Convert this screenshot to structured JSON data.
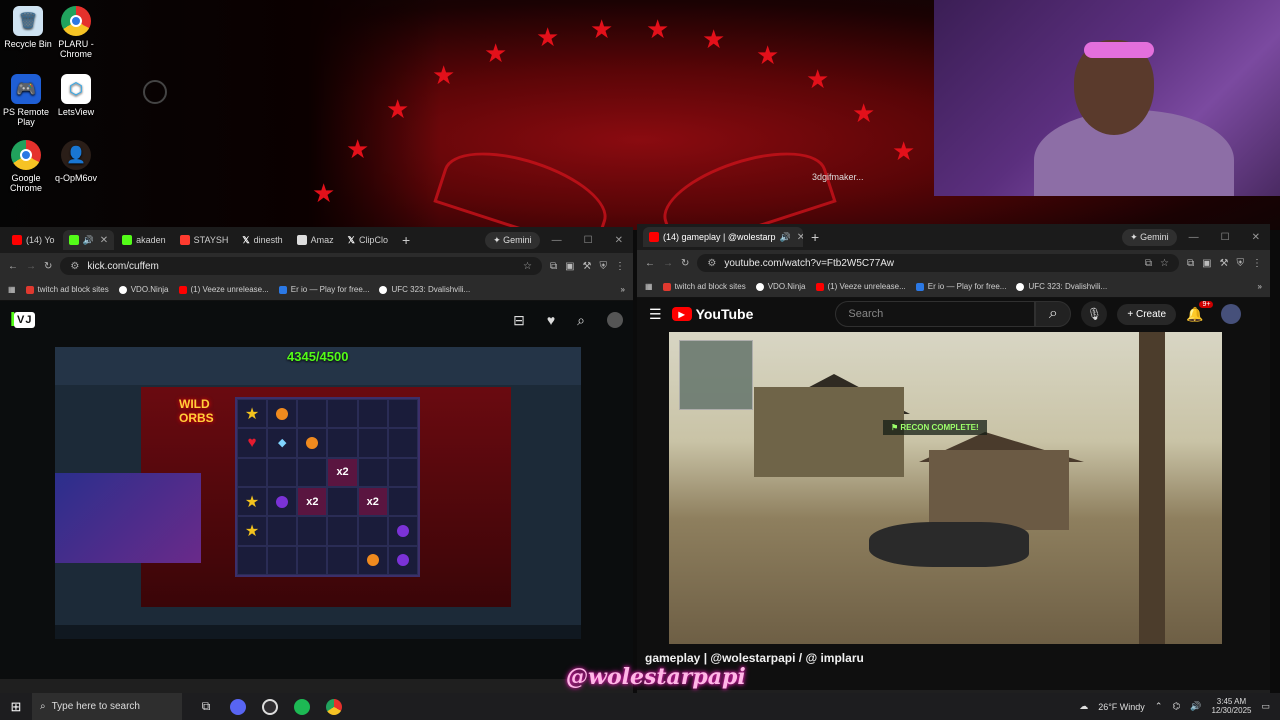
{
  "desktop": {
    "icons": [
      {
        "label": "Recycle Bin",
        "icon": "recycle-bin-icon",
        "color": "#9ecbea"
      },
      {
        "label": "PLARU - Chrome",
        "icon": "chrome-icon",
        "color": "#e5312c"
      },
      {
        "label": "PS Remote Play",
        "icon": "ps-remote-play-icon",
        "color": "#1f5fd6"
      },
      {
        "label": "LetsView",
        "icon": "letsview-icon",
        "color": "#2ea7e9"
      },
      {
        "label": "Google Chrome",
        "icon": "chrome-icon",
        "color": "#e5312c"
      },
      {
        "label": "q-OpM6ov",
        "icon": "user-avatar-icon",
        "color": "#6a4a3a"
      }
    ],
    "overlay_label": "3dgifmaker..."
  },
  "kick_window": {
    "tabs": [
      {
        "label": "(14) Yo",
        "icon": "youtube-icon",
        "color": "#ff0000"
      },
      {
        "label": "",
        "icon": "kick-icon",
        "color": "#53fc18",
        "active": true
      },
      {
        "label": "akaden",
        "icon": "kick-icon",
        "color": "#53fc18"
      },
      {
        "label": "STAYSH",
        "icon": "youtube-icon",
        "color": "#ff3b2f"
      },
      {
        "label": "dinesth",
        "icon": "x-icon",
        "color": "#ffffff"
      },
      {
        "label": "Amaz",
        "icon": "amazon-icon",
        "color": "#dddddd"
      },
      {
        "label": "ClipClo",
        "icon": "x-icon",
        "color": "#ffffff"
      }
    ],
    "gemini_label": "Gemini",
    "url": "kick.com/cuffem",
    "bookmarks": [
      {
        "label": "twitch ad block sites",
        "color": "#e0392f"
      },
      {
        "label": "VDO.Ninja",
        "color": "#ffffff"
      },
      {
        "label": "(1) Veeze unrelease...",
        "color": "#ff0000"
      },
      {
        "label": "Er io — Play for free...",
        "color": "#2b78e4"
      },
      {
        "label": "UFC 323: Dvalishvili...",
        "color": "#ffffff"
      }
    ],
    "brand": "KI",
    "brand_badge": "VJ",
    "stream": {
      "counter": "4345/4500",
      "multipliers": [
        "x2",
        "x2",
        "x2",
        "x2"
      ]
    }
  },
  "youtube_window": {
    "tabs": [
      {
        "label": "(14) gameplay | @wolestarp",
        "icon": "youtube-icon",
        "color": "#ff0000",
        "active": true
      }
    ],
    "gemini_label": "Gemini",
    "url": "youtube.com/watch?v=Ftb2W5C77Aw",
    "bookmarks": [
      {
        "label": "twitch ad block sites",
        "color": "#e0392f"
      },
      {
        "label": "VDO.Ninja",
        "color": "#ffffff"
      },
      {
        "label": "(1) Veeze unrelease...",
        "color": "#ff0000"
      },
      {
        "label": "Er io — Play for free...",
        "color": "#2b78e4"
      },
      {
        "label": "UFC 323: Dvalishvili...",
        "color": "#ffffff"
      }
    ],
    "logo": "YouTube",
    "search_placeholder": "Search",
    "create_label": "Create",
    "notification_count": "9+",
    "video": {
      "recon_text": "RECON COMPLETE!",
      "title": "gameplay | @wolestarpapi / @ implaru"
    }
  },
  "watermark": "@wolestarpapi",
  "taskbar": {
    "search_placeholder": "Type here to search",
    "weather": "26°F  Windy",
    "time": "3:45 AM",
    "date": "12/30/2025"
  }
}
